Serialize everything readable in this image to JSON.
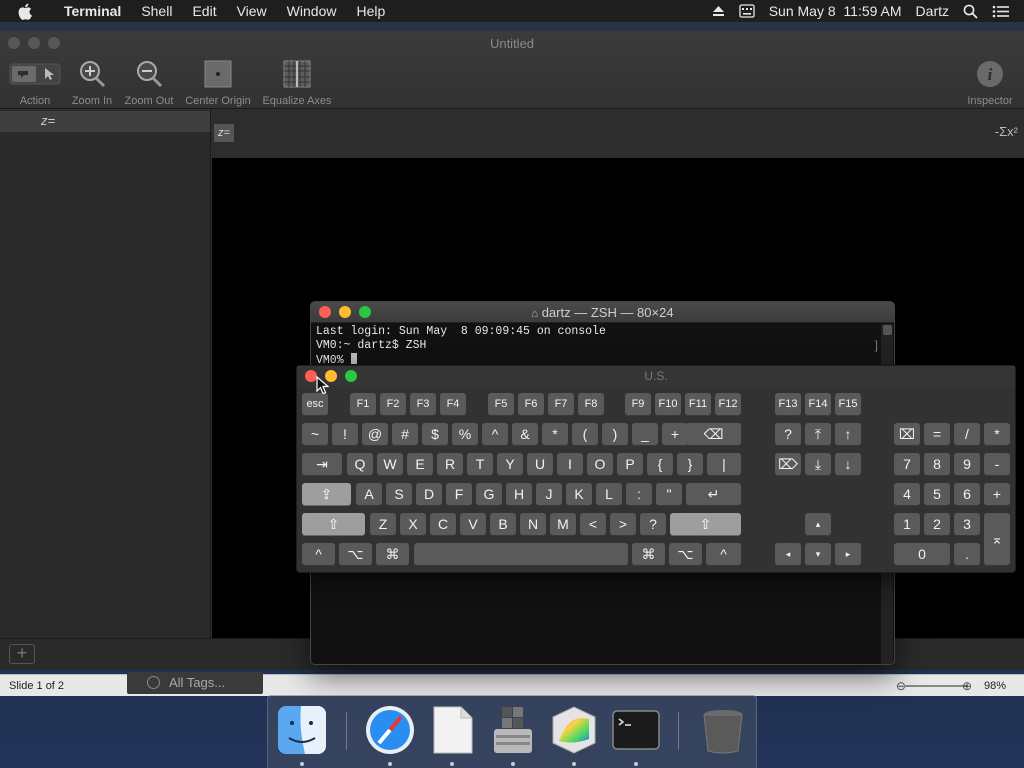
{
  "menubar": {
    "app_name": "Terminal",
    "menus": [
      "Shell",
      "Edit",
      "View",
      "Window",
      "Help"
    ],
    "clock": "Sun May 8  11:59 AM",
    "user": "Dartz"
  },
  "back_window": {
    "title": "Untitled",
    "toolbar": {
      "action": "Action",
      "zoom_in": "Zoom In",
      "zoom_out": "Zoom Out",
      "center_origin": "Center Origin",
      "equalize_axes": "Equalize Axes",
      "inspector": "Inspector"
    },
    "sidebar_equation": "z=",
    "equation_prefix": "z=",
    "sigma_button": "-Σx²"
  },
  "slide_bar": {
    "slide_label": "Slide 1 of 2",
    "tags": "All Tags...",
    "zoom": "98%"
  },
  "terminal": {
    "title": "dartz — ZSH — 80×24",
    "lines": [
      "Last login: Sun May  8 09:09:45 on console",
      "VM0:~ dartz$ ZSH",
      "VM0% "
    ]
  },
  "keyboard_viewer": {
    "title": "U.S.",
    "rows": {
      "fn": [
        "esc",
        "F1",
        "F2",
        "F3",
        "F4",
        "F5",
        "F6",
        "F7",
        "F8",
        "F9",
        "F10",
        "F11",
        "F12",
        "F13",
        "F14",
        "F15"
      ],
      "numbers": [
        "~",
        "!",
        "@",
        "#",
        "$",
        "%",
        "^",
        "&",
        "*",
        "(",
        ")",
        "_",
        "+",
        "⌫"
      ],
      "top": [
        "⇥",
        "Q",
        "W",
        "E",
        "R",
        "T",
        "Y",
        "U",
        "I",
        "O",
        "P",
        "{",
        "}",
        "|"
      ],
      "home": [
        "⇪",
        "A",
        "S",
        "D",
        "F",
        "G",
        "H",
        "J",
        "K",
        "L",
        ":",
        "\"",
        "↵"
      ],
      "bottom": [
        "⇧",
        "Z",
        "X",
        "C",
        "V",
        "B",
        "N",
        "M",
        "<",
        ">",
        "?",
        "⇧"
      ],
      "space": [
        "^",
        "⌥",
        "⌘",
        "",
        "⌘",
        "⌥",
        "^"
      ],
      "nav": [
        "?",
        "⤒",
        "↑",
        "⌦",
        "⤓",
        "↓"
      ],
      "arrows": [
        "▴",
        "◂",
        "▾",
        "▸"
      ],
      "numpad": [
        "⌧",
        "=",
        "/",
        "*",
        "7",
        "8",
        "9",
        "-",
        "4",
        "5",
        "6",
        "+",
        "1",
        "2",
        "3",
        "⌅",
        "0",
        "."
      ]
    }
  },
  "dock": {
    "icons": [
      "finder-icon",
      "safari-icon",
      "textedit-icon",
      "boot-camp-icon",
      "grapher-icon",
      "terminal-icon",
      "trash-icon"
    ]
  },
  "colors": {
    "close": "#ff5f57",
    "minimize": "#febc2e",
    "zoom": "#28c840"
  }
}
